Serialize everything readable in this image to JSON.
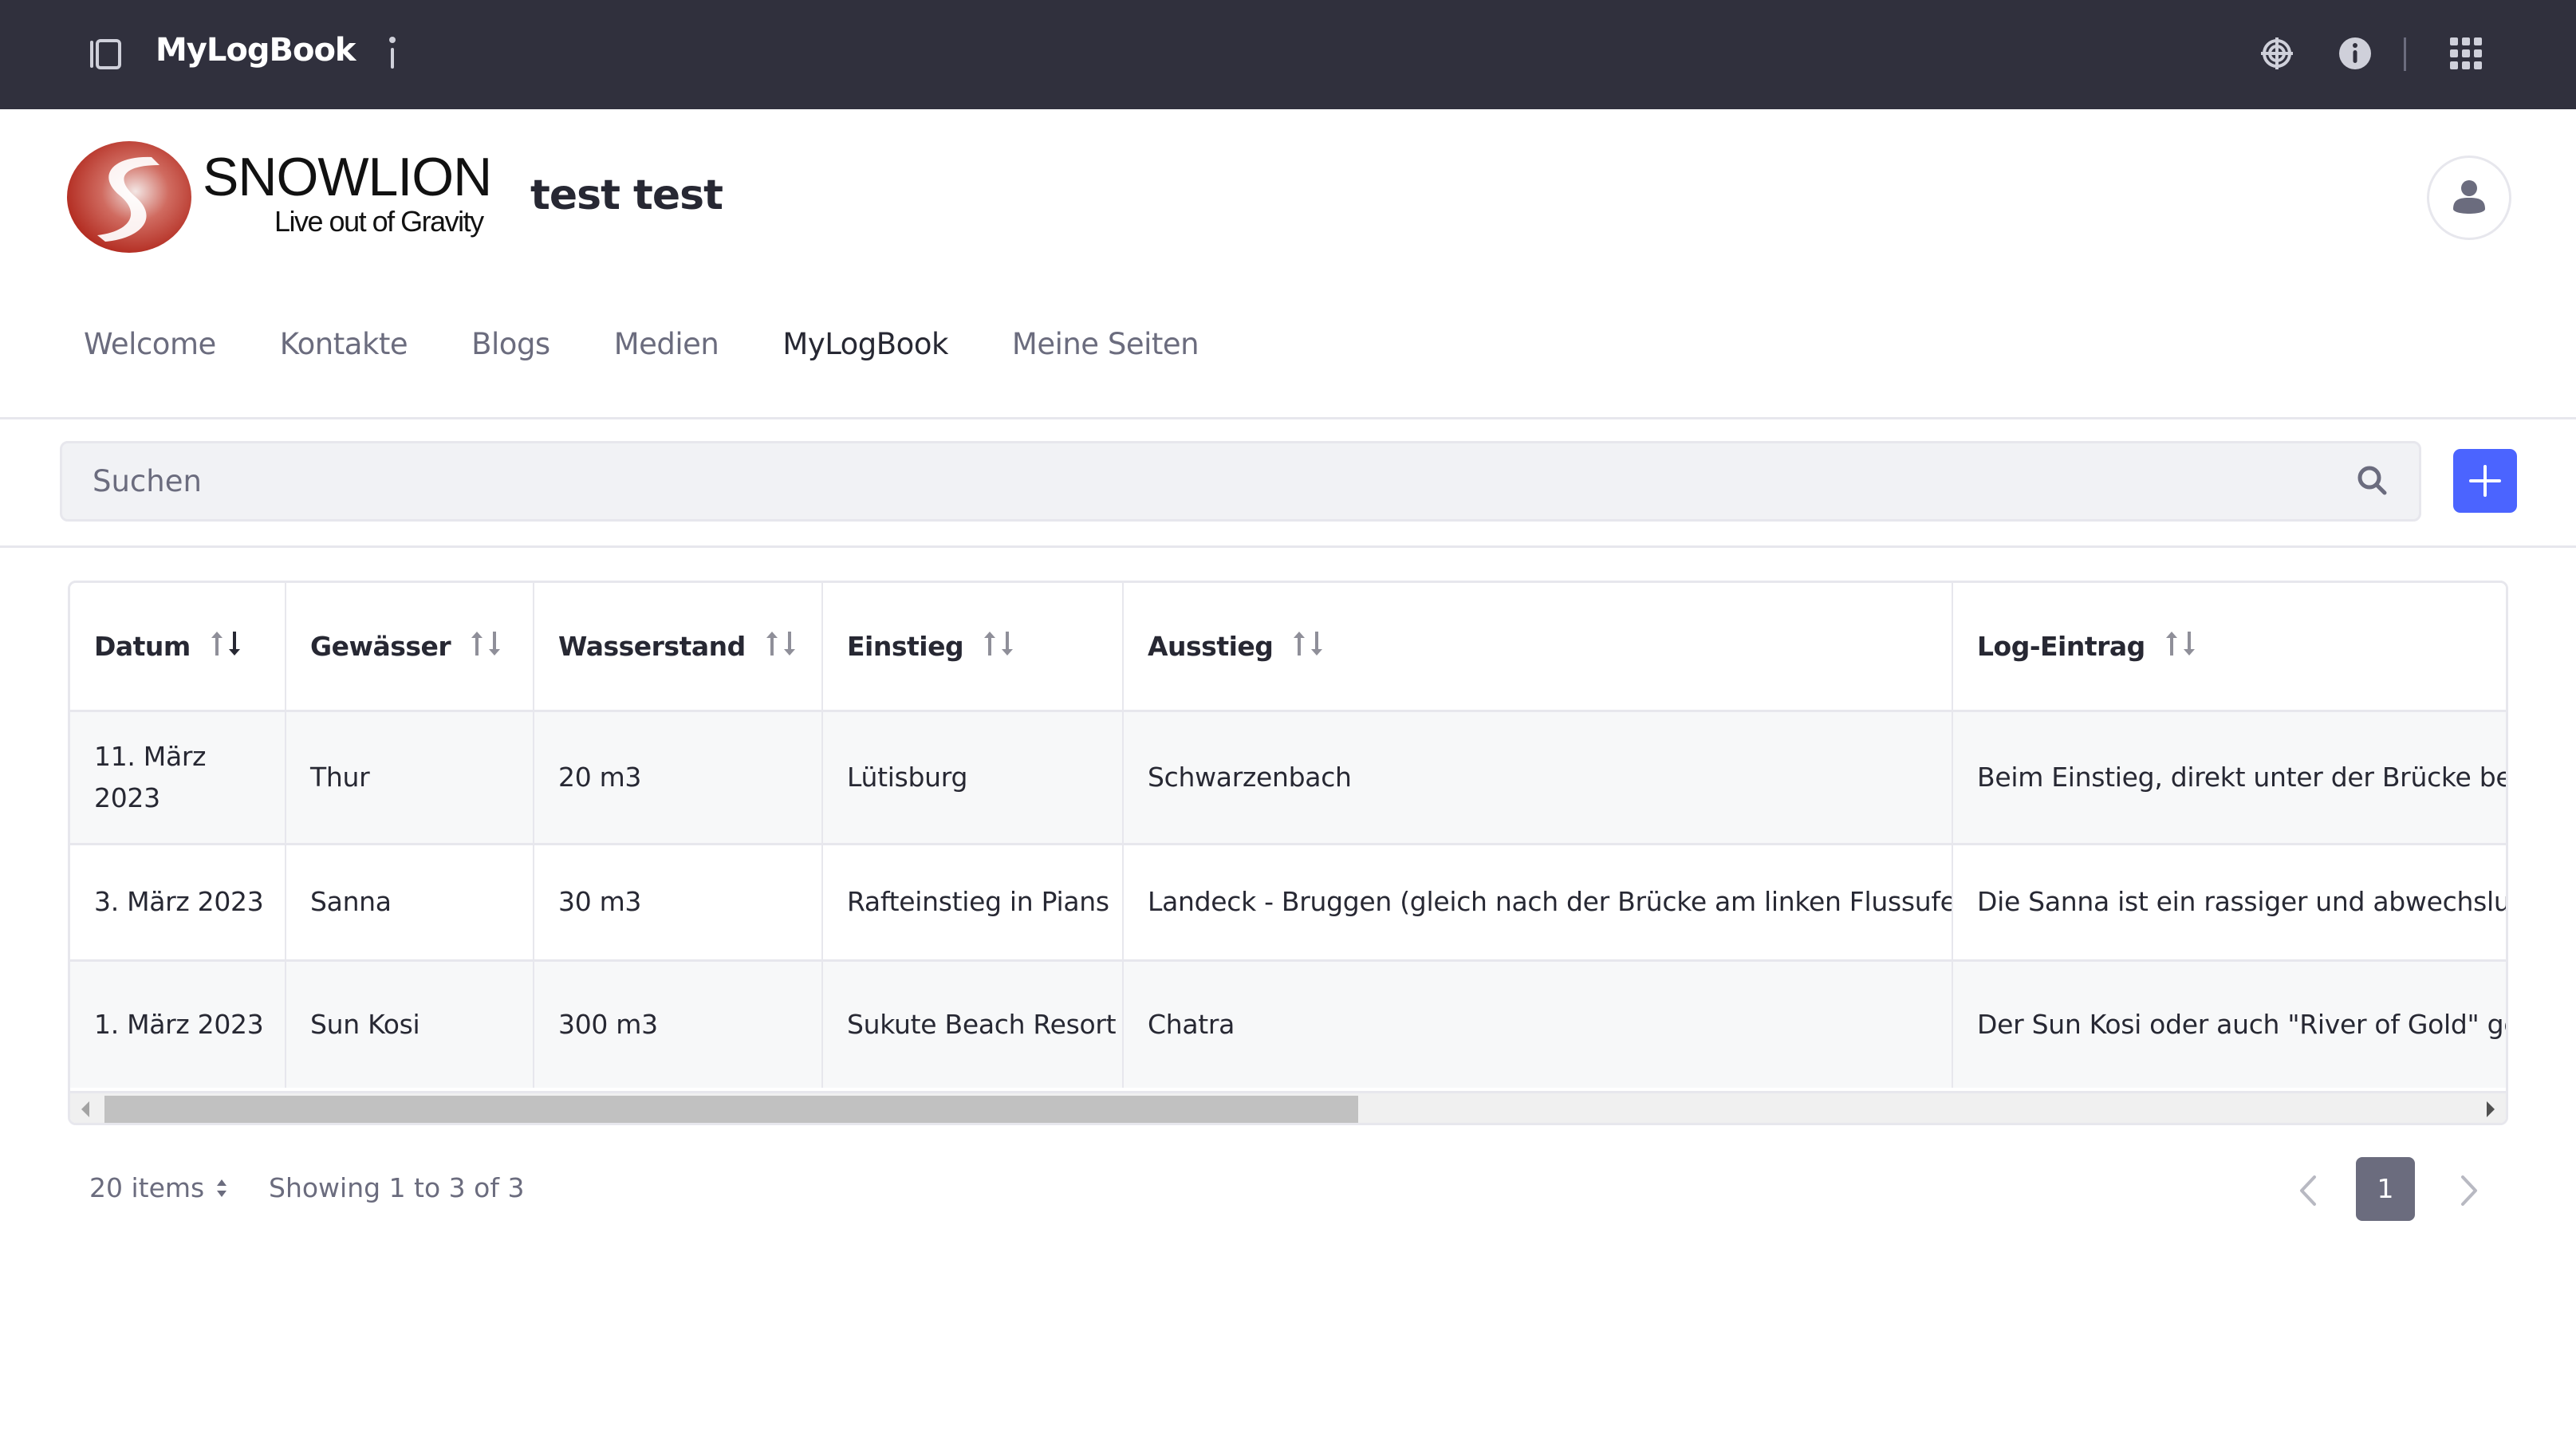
{
  "topbar": {
    "title": "MyLogBook",
    "icons": [
      "sidebar-toggle-icon",
      "info-i-icon",
      "simulation-target-icon",
      "info-circle-icon",
      "apps-grid-icon"
    ]
  },
  "header": {
    "logo": {
      "brand": "SNOWLION",
      "tagline": "Live out of Gravity",
      "accent_color": "#b0261b"
    },
    "site_name": "test test",
    "avatar_icon": "user-icon"
  },
  "nav": {
    "items": [
      {
        "label": "Welcome",
        "active": false
      },
      {
        "label": "Kontakte",
        "active": false
      },
      {
        "label": "Blogs",
        "active": false
      },
      {
        "label": "Medien",
        "active": false
      },
      {
        "label": "MyLogBook",
        "active": true
      },
      {
        "label": "Meine Seiten",
        "active": false
      }
    ]
  },
  "search": {
    "placeholder": "Suchen",
    "value": "",
    "add_button_color": "#4b64ff"
  },
  "table": {
    "columns": [
      {
        "label": "Datum",
        "sort": "descending"
      },
      {
        "label": "Gewässer",
        "sort": "none"
      },
      {
        "label": "Wasserstand",
        "sort": "none"
      },
      {
        "label": "Einstieg",
        "sort": "none"
      },
      {
        "label": "Ausstieg",
        "sort": "none"
      },
      {
        "label": "Log-Eintrag",
        "sort": "none"
      }
    ],
    "rows": [
      [
        "11. März 2023",
        "Thur",
        "20 m3",
        "Lütisburg",
        "Schwarzenbach",
        "Beim Einstieg, direkt unter der Brücke befin"
      ],
      [
        "3. März 2023",
        "Sanna",
        "30 m3",
        "Rafteinstieg in Pians",
        "Landeck - Bruggen (gleich nach der Brücke am linken Flussufer)",
        "Die Sanna ist ein rassiger und abwechslung"
      ],
      [
        "1. März 2023",
        "Sun Kosi",
        "300 m3",
        "Sukute Beach Resort",
        "Chatra",
        "Der Sun Kosi oder auch \"River of Gold\" gen"
      ]
    ],
    "horizontal_scroll_position": 0
  },
  "pagination": {
    "items_per_page": "20 items",
    "showing": "Showing 1 to 3 of 3",
    "current_page": "1",
    "pages": [
      "1"
    ]
  }
}
